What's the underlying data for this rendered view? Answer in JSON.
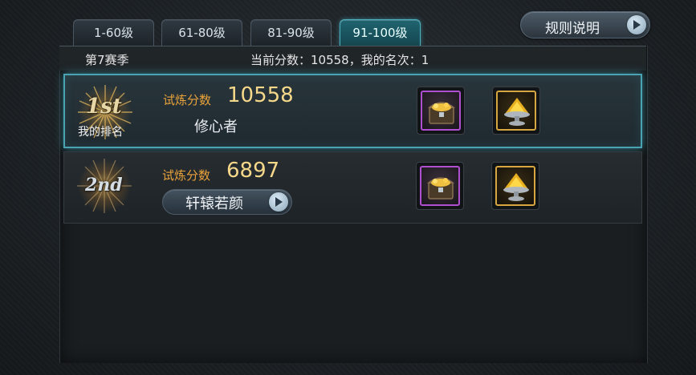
{
  "tabs": [
    {
      "label": "1-60级",
      "active": false
    },
    {
      "label": "61-80级",
      "active": false
    },
    {
      "label": "81-90级",
      "active": false
    },
    {
      "label": "91-100级",
      "active": true
    }
  ],
  "rules_button": {
    "label": "规则说明",
    "icon": "play-arrow-icon"
  },
  "header": {
    "season": "第7赛季",
    "current_info": "当前分数：10558，我的名次：1"
  },
  "rows": [
    {
      "rank_text": "1st",
      "rank_caption": "我的排名",
      "score_label": "试炼分数",
      "score": "10558",
      "player_name": "修心者",
      "rewards": [
        "treasure-chest-icon",
        "gold-pile-icon"
      ]
    },
    {
      "rank_text": "2nd",
      "score_label": "试炼分数",
      "score": "6897",
      "player_name": "轩辕若颜",
      "name_button_icon": "play-arrow-icon",
      "rewards": [
        "treasure-chest-icon",
        "gold-pile-icon"
      ]
    }
  ],
  "colors": {
    "active_tab": "#1f6470",
    "score_label": "#e9a23a",
    "score_value": "#f5d88a",
    "highlight_border": "#4aa3b3",
    "epic_border": "#b04fd0",
    "legendary_border": "#d7a640"
  }
}
